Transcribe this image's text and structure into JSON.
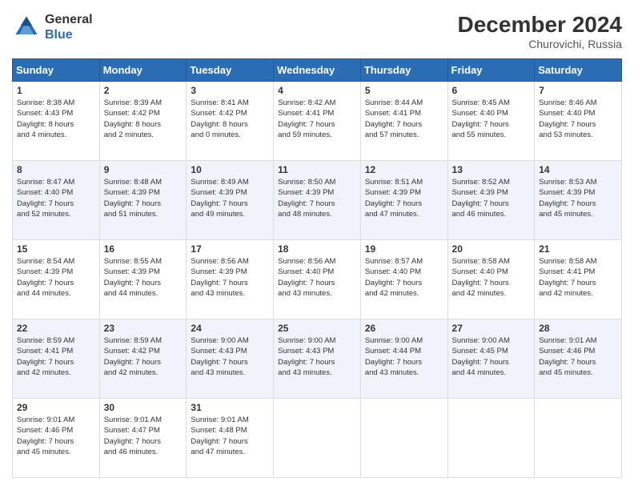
{
  "header": {
    "logo_line1": "General",
    "logo_line2": "Blue",
    "month_year": "December 2024",
    "location": "Churovichi, Russia"
  },
  "weekdays": [
    "Sunday",
    "Monday",
    "Tuesday",
    "Wednesday",
    "Thursday",
    "Friday",
    "Saturday"
  ],
  "weeks": [
    [
      {
        "day": "1",
        "info": "Sunrise: 8:38 AM\nSunset: 4:43 PM\nDaylight: 8 hours\nand 4 minutes."
      },
      {
        "day": "2",
        "info": "Sunrise: 8:39 AM\nSunset: 4:42 PM\nDaylight: 8 hours\nand 2 minutes."
      },
      {
        "day": "3",
        "info": "Sunrise: 8:41 AM\nSunset: 4:42 PM\nDaylight: 8 hours\nand 0 minutes."
      },
      {
        "day": "4",
        "info": "Sunrise: 8:42 AM\nSunset: 4:41 PM\nDaylight: 7 hours\nand 59 minutes."
      },
      {
        "day": "5",
        "info": "Sunrise: 8:44 AM\nSunset: 4:41 PM\nDaylight: 7 hours\nand 57 minutes."
      },
      {
        "day": "6",
        "info": "Sunrise: 8:45 AM\nSunset: 4:40 PM\nDaylight: 7 hours\nand 55 minutes."
      },
      {
        "day": "7",
        "info": "Sunrise: 8:46 AM\nSunset: 4:40 PM\nDaylight: 7 hours\nand 53 minutes."
      }
    ],
    [
      {
        "day": "8",
        "info": "Sunrise: 8:47 AM\nSunset: 4:40 PM\nDaylight: 7 hours\nand 52 minutes."
      },
      {
        "day": "9",
        "info": "Sunrise: 8:48 AM\nSunset: 4:39 PM\nDaylight: 7 hours\nand 51 minutes."
      },
      {
        "day": "10",
        "info": "Sunrise: 8:49 AM\nSunset: 4:39 PM\nDaylight: 7 hours\nand 49 minutes."
      },
      {
        "day": "11",
        "info": "Sunrise: 8:50 AM\nSunset: 4:39 PM\nDaylight: 7 hours\nand 48 minutes."
      },
      {
        "day": "12",
        "info": "Sunrise: 8:51 AM\nSunset: 4:39 PM\nDaylight: 7 hours\nand 47 minutes."
      },
      {
        "day": "13",
        "info": "Sunrise: 8:52 AM\nSunset: 4:39 PM\nDaylight: 7 hours\nand 46 minutes."
      },
      {
        "day": "14",
        "info": "Sunrise: 8:53 AM\nSunset: 4:39 PM\nDaylight: 7 hours\nand 45 minutes."
      }
    ],
    [
      {
        "day": "15",
        "info": "Sunrise: 8:54 AM\nSunset: 4:39 PM\nDaylight: 7 hours\nand 44 minutes."
      },
      {
        "day": "16",
        "info": "Sunrise: 8:55 AM\nSunset: 4:39 PM\nDaylight: 7 hours\nand 44 minutes."
      },
      {
        "day": "17",
        "info": "Sunrise: 8:56 AM\nSunset: 4:39 PM\nDaylight: 7 hours\nand 43 minutes."
      },
      {
        "day": "18",
        "info": "Sunrise: 8:56 AM\nSunset: 4:40 PM\nDaylight: 7 hours\nand 43 minutes."
      },
      {
        "day": "19",
        "info": "Sunrise: 8:57 AM\nSunset: 4:40 PM\nDaylight: 7 hours\nand 42 minutes."
      },
      {
        "day": "20",
        "info": "Sunrise: 8:58 AM\nSunset: 4:40 PM\nDaylight: 7 hours\nand 42 minutes."
      },
      {
        "day": "21",
        "info": "Sunrise: 8:58 AM\nSunset: 4:41 PM\nDaylight: 7 hours\nand 42 minutes."
      }
    ],
    [
      {
        "day": "22",
        "info": "Sunrise: 8:59 AM\nSunset: 4:41 PM\nDaylight: 7 hours\nand 42 minutes."
      },
      {
        "day": "23",
        "info": "Sunrise: 8:59 AM\nSunset: 4:42 PM\nDaylight: 7 hours\nand 42 minutes."
      },
      {
        "day": "24",
        "info": "Sunrise: 9:00 AM\nSunset: 4:43 PM\nDaylight: 7 hours\nand 43 minutes."
      },
      {
        "day": "25",
        "info": "Sunrise: 9:00 AM\nSunset: 4:43 PM\nDaylight: 7 hours\nand 43 minutes."
      },
      {
        "day": "26",
        "info": "Sunrise: 9:00 AM\nSunset: 4:44 PM\nDaylight: 7 hours\nand 43 minutes."
      },
      {
        "day": "27",
        "info": "Sunrise: 9:00 AM\nSunset: 4:45 PM\nDaylight: 7 hours\nand 44 minutes."
      },
      {
        "day": "28",
        "info": "Sunrise: 9:01 AM\nSunset: 4:46 PM\nDaylight: 7 hours\nand 45 minutes."
      }
    ],
    [
      {
        "day": "29",
        "info": "Sunrise: 9:01 AM\nSunset: 4:46 PM\nDaylight: 7 hours\nand 45 minutes."
      },
      {
        "day": "30",
        "info": "Sunrise: 9:01 AM\nSunset: 4:47 PM\nDaylight: 7 hours\nand 46 minutes."
      },
      {
        "day": "31",
        "info": "Sunrise: 9:01 AM\nSunset: 4:48 PM\nDaylight: 7 hours\nand 47 minutes."
      },
      {
        "day": "",
        "info": ""
      },
      {
        "day": "",
        "info": ""
      },
      {
        "day": "",
        "info": ""
      },
      {
        "day": "",
        "info": ""
      }
    ]
  ]
}
